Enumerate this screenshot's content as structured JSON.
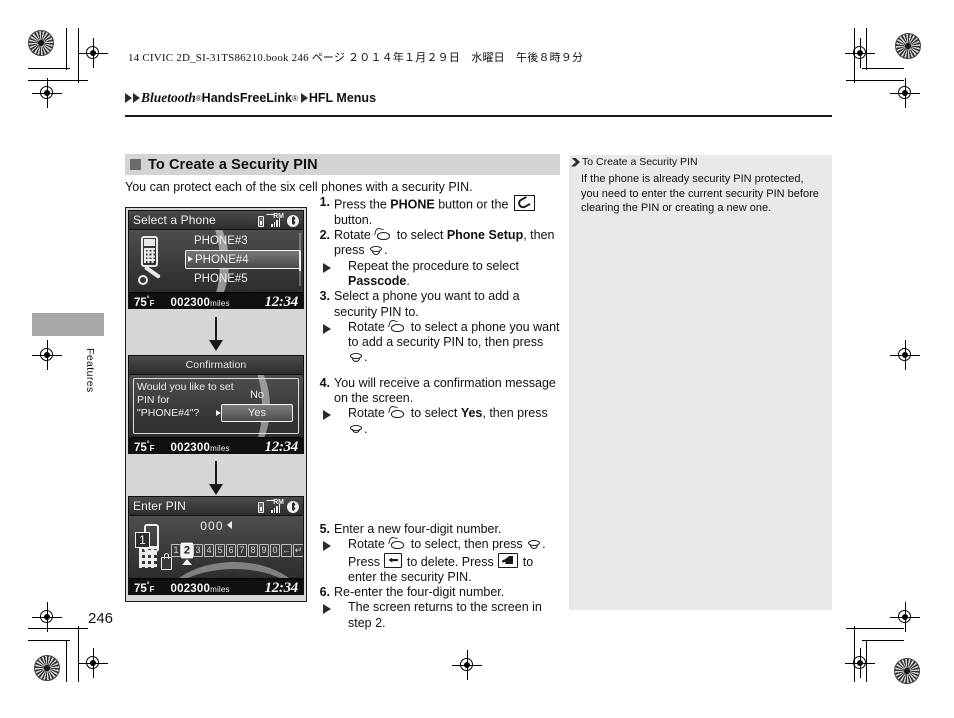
{
  "book_line": "14 CIVIC 2D_SI-31TS86210.book   246 ページ   ２０１４年１月２９日　水曜日　午後８時９分",
  "breadcrumb": {
    "bluetooth": "Bluetooth",
    "reg1": "®",
    "handsfree": " HandsFreeLink",
    "reg2": "®",
    "section": "HFL Menus"
  },
  "page_number": "246",
  "tab_label": "Features",
  "section": {
    "title": "To Create a Security PIN",
    "intro": "You can protect each of the six cell phones with a security PIN."
  },
  "steps": [
    {
      "num": "1.",
      "parts": [
        {
          "t": "text",
          "v": "Press the "
        },
        {
          "t": "bold",
          "v": "PHONE"
        },
        {
          "t": "text",
          "v": " button or the "
        },
        {
          "t": "icon",
          "v": "phone-button-icon"
        },
        {
          "t": "text",
          "v": " button."
        }
      ],
      "subs": []
    },
    {
      "num": "2.",
      "parts": [
        {
          "t": "text",
          "v": "Rotate "
        },
        {
          "t": "icon",
          "v": "rotate-dial-icon"
        },
        {
          "t": "text",
          "v": " to select "
        },
        {
          "t": "bold",
          "v": "Phone Setup"
        },
        {
          "t": "text",
          "v": ", then press "
        },
        {
          "t": "icon",
          "v": "press-knob-icon"
        },
        {
          "t": "text",
          "v": "."
        }
      ],
      "subs": [
        {
          "parts": [
            {
              "t": "text",
              "v": "Repeat the procedure to select "
            },
            {
              "t": "bold",
              "v": "Passcode"
            },
            {
              "t": "text",
              "v": "."
            }
          ]
        }
      ]
    },
    {
      "num": "3.",
      "parts": [
        {
          "t": "text",
          "v": "Select a phone you want to add a security PIN to."
        }
      ],
      "subs": [
        {
          "parts": [
            {
              "t": "text",
              "v": "Rotate "
            },
            {
              "t": "icon",
              "v": "rotate-dial-icon"
            },
            {
              "t": "text",
              "v": " to select a phone you want to add a security PIN to, then press "
            },
            {
              "t": "icon",
              "v": "press-knob-icon"
            },
            {
              "t": "text",
              "v": "."
            }
          ]
        }
      ]
    },
    {
      "num": "4.",
      "parts": [
        {
          "t": "text",
          "v": "You will receive a confirmation message on the screen."
        }
      ],
      "subs": [
        {
          "parts": [
            {
              "t": "text",
              "v": "Rotate "
            },
            {
              "t": "icon",
              "v": "rotate-dial-icon"
            },
            {
              "t": "text",
              "v": " to select "
            },
            {
              "t": "bold",
              "v": "Yes"
            },
            {
              "t": "text",
              "v": ", then press "
            },
            {
              "t": "icon",
              "v": "press-knob-icon"
            },
            {
              "t": "text",
              "v": "."
            }
          ]
        }
      ]
    },
    {
      "num": "5.",
      "parts": [
        {
          "t": "text",
          "v": "Enter a new four-digit number."
        }
      ],
      "subs": [
        {
          "parts": [
            {
              "t": "text",
              "v": "Rotate "
            },
            {
              "t": "icon",
              "v": "rotate-dial-icon"
            },
            {
              "t": "text",
              "v": " to select, then press "
            },
            {
              "t": "icon",
              "v": "press-knob-icon"
            },
            {
              "t": "text",
              "v": ". Press "
            },
            {
              "t": "icon",
              "v": "backspace-button-icon"
            },
            {
              "t": "text",
              "v": " to delete. Press "
            },
            {
              "t": "icon",
              "v": "enter-button-icon"
            },
            {
              "t": "text",
              "v": " to enter the security PIN."
            }
          ]
        }
      ]
    },
    {
      "num": "6.",
      "parts": [
        {
          "t": "text",
          "v": "Re-enter the four-digit number."
        }
      ],
      "subs": [
        {
          "parts": [
            {
              "t": "text",
              "v": "The screen returns to the screen in step 2."
            }
          ]
        }
      ]
    }
  ],
  "device_screens": {
    "select_phone": {
      "title": "Select a Phone",
      "status_icons": [
        "battery-icon",
        "signal-roaming-icon",
        "bluetooth-icon"
      ],
      "roaming_label": "RM",
      "rows": [
        {
          "label": "PHONE#3",
          "selected": false
        },
        {
          "label": "PHONE#4",
          "selected": true
        },
        {
          "label": "PHONE#5",
          "selected": false
        }
      ],
      "infobar": {
        "temp": "75",
        "temp_deg": "°",
        "temp_unit": "F",
        "odometer": "002300",
        "odometer_unit": "miles",
        "clock": "12:34"
      }
    },
    "confirmation": {
      "title": "Confirmation",
      "message": "Would you like to set\nPIN for\n\"PHONE#4\"?",
      "buttons": [
        {
          "label": "No",
          "selected": false
        },
        {
          "label": "Yes",
          "selected": true
        }
      ],
      "infobar": {
        "temp": "75",
        "temp_deg": "°",
        "temp_unit": "F",
        "odometer": "002300",
        "odometer_unit": "miles",
        "clock": "12:34"
      }
    },
    "enter_pin": {
      "title": "Enter PIN",
      "status_icons": [
        "battery-icon",
        "signal-roaming-icon",
        "bluetooth-icon"
      ],
      "roaming_label": "RM",
      "entered": "000",
      "phone_index": "1",
      "keys": [
        {
          "label": "1",
          "selected": false
        },
        {
          "label": "2",
          "selected": true
        },
        {
          "label": "3",
          "selected": false
        },
        {
          "label": "4",
          "selected": false
        },
        {
          "label": "5",
          "selected": false
        },
        {
          "label": "6",
          "selected": false
        },
        {
          "label": "7",
          "selected": false
        },
        {
          "label": "8",
          "selected": false
        },
        {
          "label": "9",
          "selected": false
        },
        {
          "label": "0",
          "selected": false
        },
        {
          "label": "←",
          "selected": false
        },
        {
          "label": "↵",
          "selected": false
        }
      ],
      "infobar": {
        "temp": "75",
        "temp_deg": "°",
        "temp_unit": "F",
        "odometer": "002300",
        "odometer_unit": "miles",
        "clock": "12:34"
      }
    }
  },
  "note": {
    "title": "To Create a Security PIN",
    "body": "If the phone is already security PIN protected, you need to enter the current security PIN before clearing the PIN or creating a new one."
  },
  "colors": {
    "heading_band": "#d4d4d4",
    "note_panel": "#e9e9e9",
    "shot_col": "#d6d6d6",
    "tab_mark": "#a8a8a8"
  }
}
